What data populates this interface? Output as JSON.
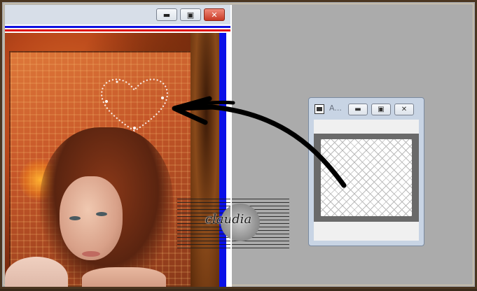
{
  "image_window": {
    "minimize_symbol": "▬",
    "maximize_symbol": "▣",
    "close_symbol": "✕",
    "watermark_text": "claudia"
  },
  "preview_window": {
    "title": "A...",
    "minimize_symbol": "▬",
    "maximize_symbol": "▣",
    "close_symbol": "✕"
  },
  "annotation": {
    "type": "hand-drawn arrow",
    "color": "#000000"
  },
  "colors": {
    "desktop_background": "#ababab",
    "blue_border": "#0a10e8",
    "red_stripe": "#e01010",
    "window_chrome": "#c8d4e4",
    "close_button": "#c83a26"
  }
}
